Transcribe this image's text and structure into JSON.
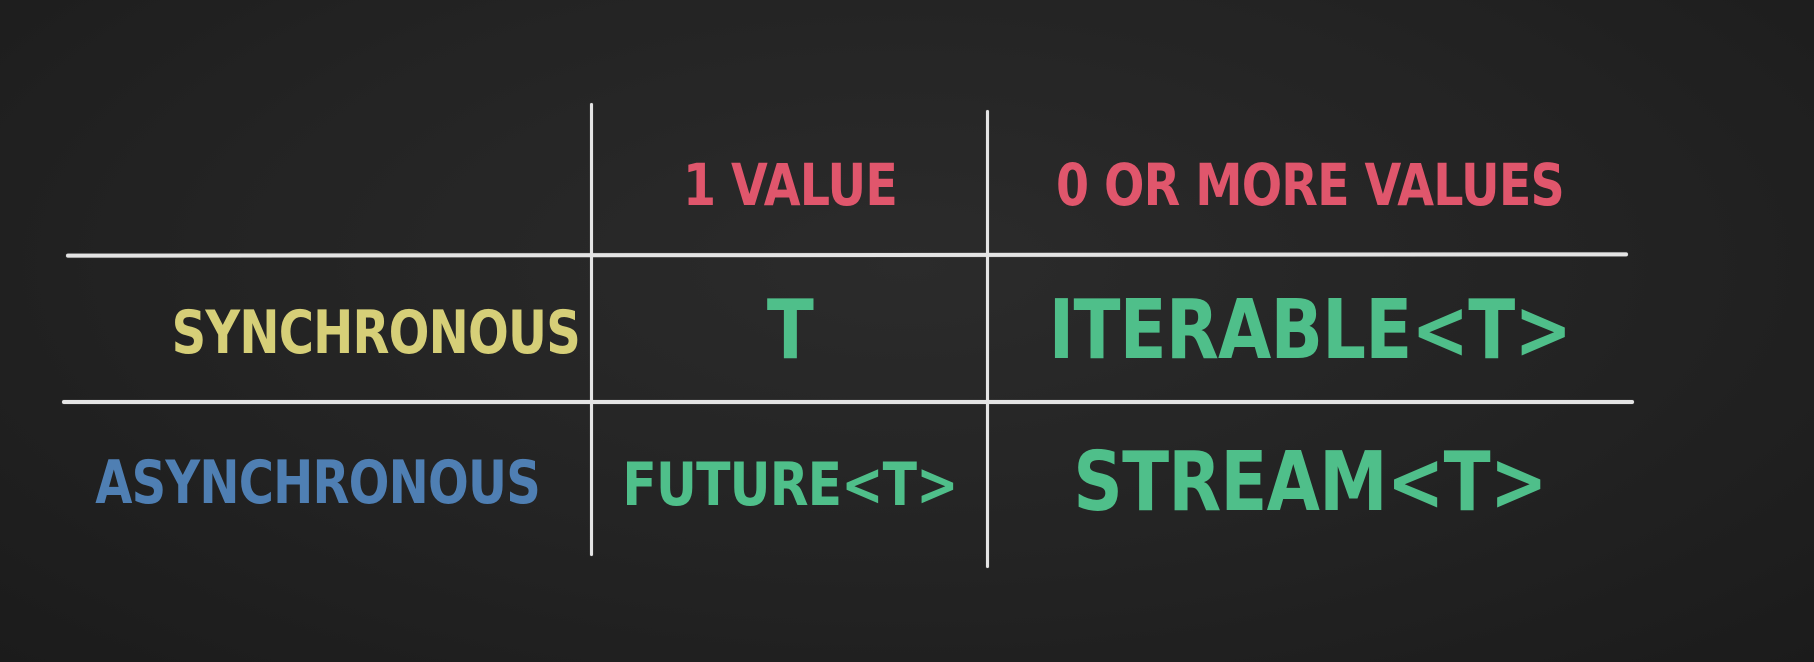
{
  "colors": {
    "header": "#e0566c",
    "sync": "#d6cf78",
    "async": "#4f7fb3",
    "types": "#4fbf8a",
    "lines": "#e4e4e4",
    "background": "#232323"
  },
  "table": {
    "columns": [
      "1 VALUE",
      "0 OR MORE VALUES"
    ],
    "rows": [
      {
        "label": "SYNCHRONOUS",
        "cells": [
          "T",
          "ITERABLE<T>"
        ]
      },
      {
        "label": "ASYNCHRONOUS",
        "cells": [
          "FUTURE<T>",
          "STREAM<T>"
        ]
      }
    ]
  }
}
